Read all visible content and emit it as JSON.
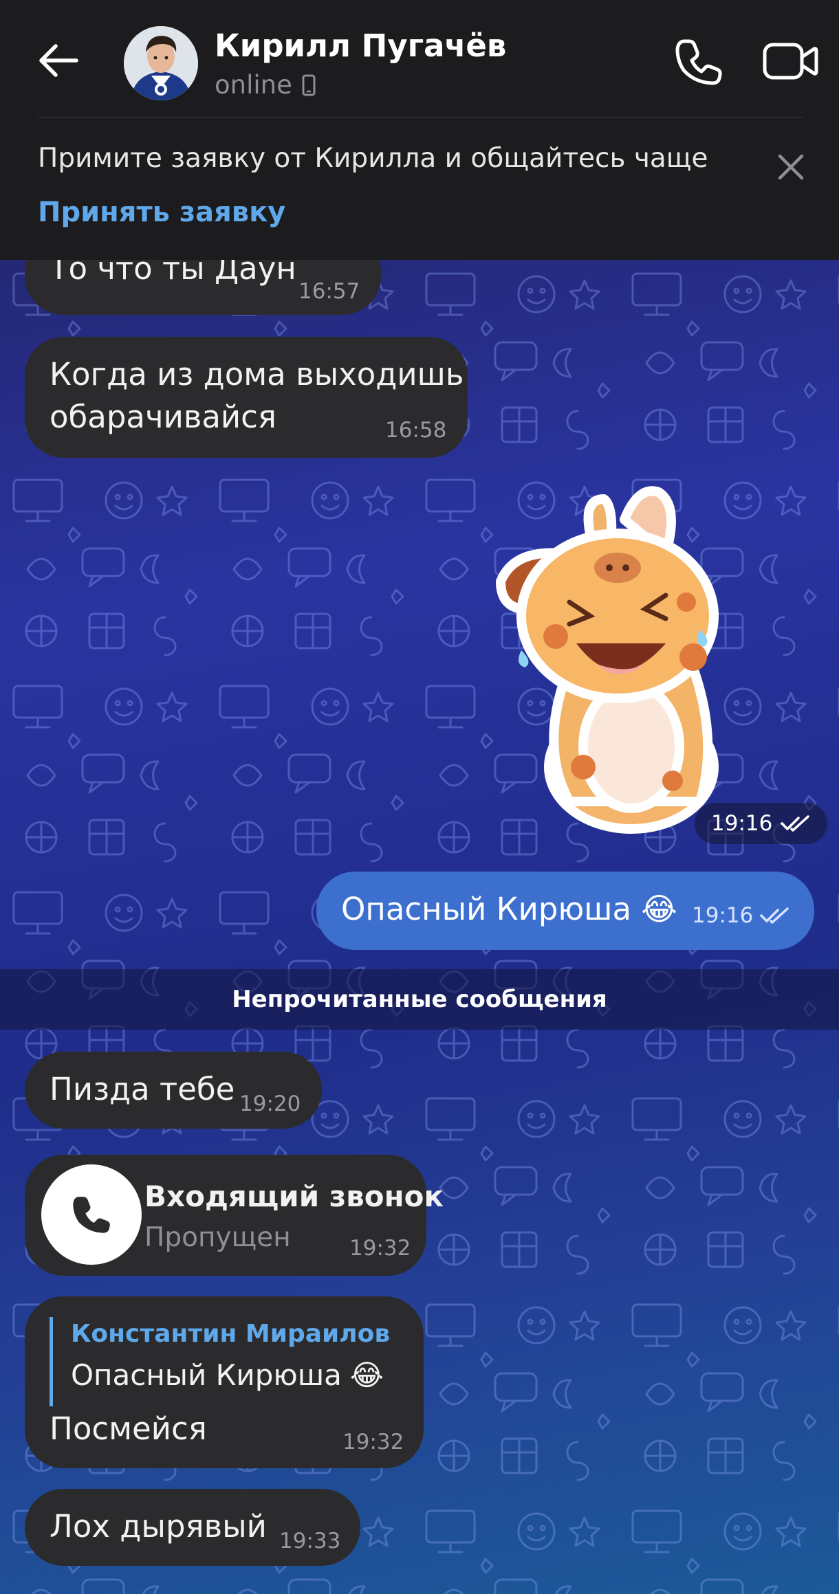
{
  "header": {
    "contact_name": "Кирилл Пугачёв",
    "status": "online",
    "icons": {
      "back": "arrow-left-icon",
      "call": "phone-icon",
      "video": "video-camera-icon",
      "device": "phone-device-icon",
      "close": "close-icon"
    }
  },
  "banner": {
    "text": "Примите заявку от Кирилла и общайтесь чаще",
    "action": "Принять заявку"
  },
  "messages": [
    {
      "direction": "in",
      "text": "То что ты Даун",
      "time": "16:57"
    },
    {
      "direction": "in",
      "lines": [
        "Когда из дома выходишь",
        "обарачивайся"
      ],
      "time": "16:58"
    },
    {
      "direction": "out",
      "type": "sticker",
      "time": "19:16",
      "read": true
    },
    {
      "direction": "out",
      "text": "Опасный Кирюша",
      "emoji": "😂",
      "time": "19:16",
      "read": true
    }
  ],
  "unread_divider": "Непрочитанные сообщения",
  "unread_messages": [
    {
      "direction": "in",
      "text": "Пизда тебе",
      "time": "19:20"
    },
    {
      "direction": "in",
      "type": "call",
      "title": "Входящий звонок",
      "subtitle": "Пропущен",
      "time": "19:32"
    },
    {
      "direction": "in",
      "type": "reply",
      "reply_author": "Константин Мираилов",
      "reply_text": "Опасный Кирюша",
      "reply_emoji": "😂",
      "text": "Посмейся",
      "time": "19:32"
    },
    {
      "direction": "in",
      "text": "Лох дырявый",
      "time": "19:33"
    }
  ],
  "colors": {
    "header_bg": "#1c1c1e",
    "accent": "#5fa8ea",
    "bubble_in": "#2b2b2d",
    "bubble_out": "#3d6fcf",
    "chat_gradient_start": "#242875",
    "chat_gradient_end": "#1c5a98"
  }
}
